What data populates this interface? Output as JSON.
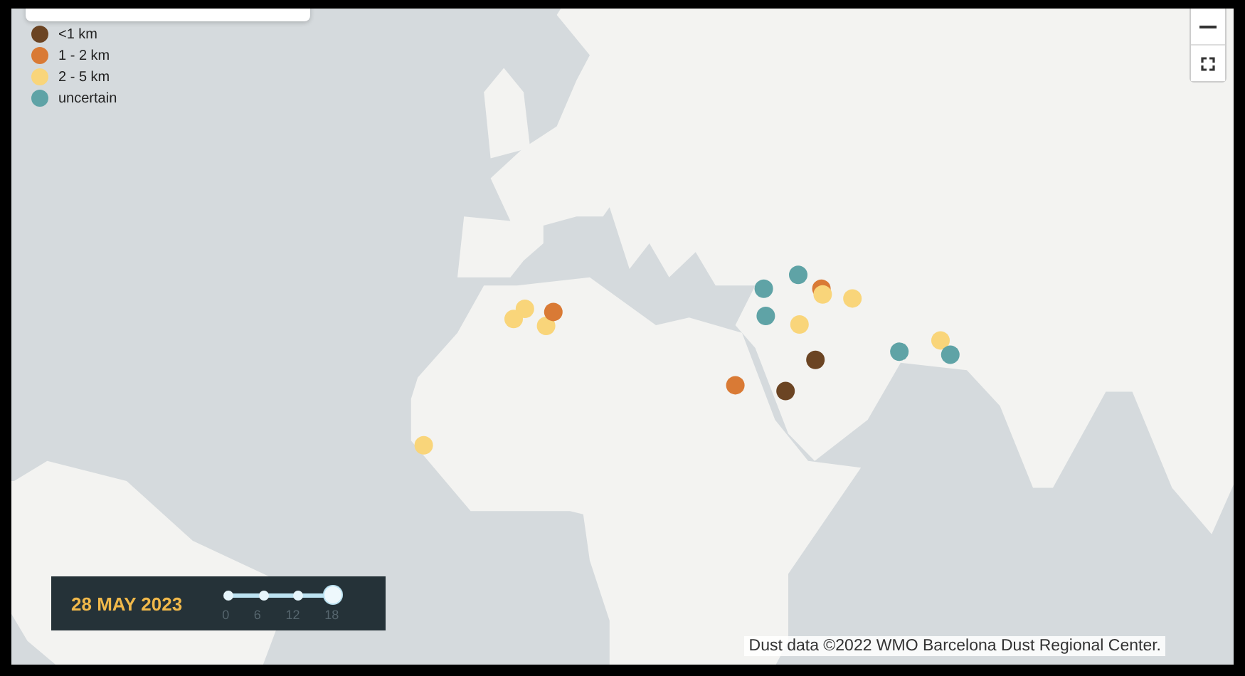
{
  "legend": {
    "items": [
      {
        "label": "<1 km",
        "color": "#6b4423"
      },
      {
        "label": "1 - 2 km",
        "color": "#d97a35"
      },
      {
        "label": "2 - 5 km",
        "color": "#f9d57a"
      },
      {
        "label": "uncertain",
        "color": "#5fa3a6"
      }
    ]
  },
  "markers": [
    {
      "color": "#f9d57a"
    },
    {
      "color": "#f9d57a"
    },
    {
      "color": "#f9d57a"
    },
    {
      "color": "#d97a35"
    },
    {
      "color": "#f9d57a"
    },
    {
      "color": "#d97a35"
    },
    {
      "color": "#6b4423"
    },
    {
      "color": "#6b4423"
    },
    {
      "color": "#5fa3a6"
    },
    {
      "color": "#5fa3a6"
    },
    {
      "color": "#5fa3a6"
    },
    {
      "color": "#d97a35"
    },
    {
      "color": "#f9d57a"
    },
    {
      "color": "#f9d57a"
    },
    {
      "color": "#f9d57a"
    },
    {
      "color": "#5fa3a6"
    },
    {
      "color": "#f9d57a"
    },
    {
      "color": "#5fa3a6"
    }
  ],
  "time_control": {
    "date": "28 MAY 2023",
    "ticks": [
      "0",
      "6",
      "12",
      "18"
    ],
    "level": 1
  },
  "attribution": "Dust data ©2022 WMO Barcelona Dust Regional Center."
}
